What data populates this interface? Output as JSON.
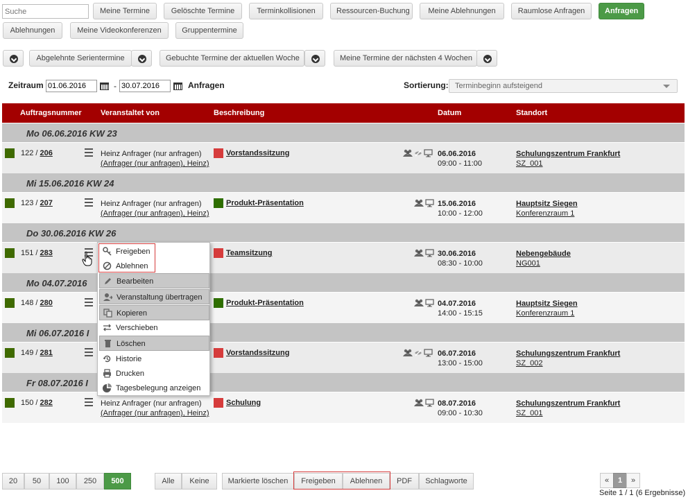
{
  "search": {
    "placeholder": "Suche"
  },
  "tabs": [
    "Meine Termine",
    "Gelöschte Termine",
    "Terminkollisionen",
    "Ressourcen-Buchung",
    "Meine Ablehnungen",
    "Raumlose Anfragen",
    "Anfragen",
    "Ablehnungen",
    "Meine Videokonferenzen",
    "Gruppentermine"
  ],
  "active_tab": "Anfragen",
  "quick_filters": [
    "Abgelehnte Serientermine",
    "Gebuchte Termine der aktuellen Woche",
    "Meine Termine der nächsten 4 Wochen"
  ],
  "filter": {
    "range_label": "Zeitraum",
    "date_from": "01.06.2016",
    "separator": "-",
    "date_to": "30.07.2016",
    "submit": "Anfragen",
    "sort_label": "Sortierung:",
    "sort_value": "Terminbeginn aufsteigend"
  },
  "columns": [
    "Auftragsnummer",
    "Veranstaltet von",
    "Beschreibung",
    "Datum",
    "Standort"
  ],
  "groups": [
    {
      "label": "Mo 06.06.2016 KW 23"
    },
    {
      "label": "Mi 15.06.2016 KW 24"
    },
    {
      "label": "Do 30.06.2016 KW 26"
    },
    {
      "label": "Mo 04.07.2016"
    },
    {
      "label": "Mi 06.07.2016 I"
    },
    {
      "label": "Fr 08.07.2016 I"
    }
  ],
  "rows": [
    {
      "num": "122 / ",
      "link": "206",
      "org1": "Heinz Anfrager (nur anfragen)",
      "org2": "(Anfrager (nur anfragen), Heinz)",
      "desc": "Vorstandssitzung",
      "desc_color": "#d63c3c",
      "date": "06.06.2016",
      "time": "09:00 - 11:00",
      "loc": "Schulungszentrum Frankfurt",
      "room": "SZ_001",
      "icons": [
        "group-icon",
        "eye-slash-icon",
        "monitor-icon"
      ]
    },
    {
      "num": "123 / ",
      "link": "207",
      "org1": "Heinz Anfrager (nur anfragen)",
      "org2": "(Anfrager (nur anfragen), Heinz)",
      "desc": "Produkt-Präsentation",
      "desc_color": "#2e6e00",
      "date": "15.06.2016",
      "time": "10:00 - 12:00",
      "loc": "Hauptsitz Siegen",
      "room": "Konferenzraum 1",
      "icons": [
        "group-icon",
        "monitor-icon"
      ]
    },
    {
      "num": "151 / ",
      "link": "283",
      "org1": "",
      "org2": "",
      "desc": "Teamsitzung",
      "desc_color": "#d63c3c",
      "date": "30.06.2016",
      "time": "08:30 - 10:00",
      "loc": "Nebengebäude",
      "room": "NG001",
      "icons": [
        "group-icon",
        "monitor-icon"
      ]
    },
    {
      "num": "148 / ",
      "link": "280",
      "org1": "",
      "org2": "",
      "desc": "Produkt-Präsentation",
      "desc_color": "#2e6e00",
      "date": "04.07.2016",
      "time": "14:00 - 15:15",
      "loc": "Hauptsitz Siegen",
      "room": "Konferenzraum 1",
      "icons": [
        "group-icon",
        "monitor-icon"
      ]
    },
    {
      "num": "149 / ",
      "link": "281",
      "org1": "",
      "org2": "",
      "desc": "Vorstandssitzung",
      "desc_color": "#d63c3c",
      "date": "06.07.2016",
      "time": "13:00 - 15:00",
      "loc": "Schulungszentrum Frankfurt",
      "room": "SZ_002",
      "icons": [
        "group-icon",
        "eye-slash-icon",
        "monitor-icon"
      ]
    },
    {
      "num": "150 / ",
      "link": "282",
      "org1": "Heinz Anfrager (nur anfragen)",
      "org2": "(Anfrager (nur anfragen), Heinz)",
      "desc": "Schulung",
      "desc_color": "#d63c3c",
      "date": "08.07.2016",
      "time": "09:00 - 10:30",
      "loc": "Schulungszentrum Frankfurt",
      "room": "SZ_001",
      "icons": [
        "group-icon",
        "monitor-icon"
      ]
    }
  ],
  "context_menu": [
    {
      "label": "Freigeben",
      "icon": "approve-icon"
    },
    {
      "label": "Ablehnen",
      "icon": "block-icon"
    },
    {
      "label": "Bearbeiten",
      "icon": "pencil-icon"
    },
    {
      "label": "Veranstaltung übertragen",
      "icon": "user-transfer-icon"
    },
    {
      "label": "Kopieren",
      "icon": "copy-icon"
    },
    {
      "label": "Verschieben",
      "icon": "arrows-icon"
    },
    {
      "label": "Löschen",
      "icon": "trash-icon"
    },
    {
      "label": "Historie",
      "icon": "history-icon"
    },
    {
      "label": "Drucken",
      "icon": "print-icon"
    },
    {
      "label": "Tagesbelegung anzeigen",
      "icon": "pie-chart-icon"
    }
  ],
  "footer": {
    "page_sizes": [
      "20",
      "50",
      "100",
      "250",
      "500"
    ],
    "active_page_size": "500",
    "select_all": "Alle",
    "select_none": "Keine",
    "delete_marked": "Markierte löschen",
    "approve": "Freigeben",
    "reject": "Ablehnen",
    "pdf": "PDF",
    "tags": "Schlagworte",
    "prev": "«",
    "page": "1",
    "next": "»",
    "summary": "Seite 1 / 1 (6 Ergebnisse)"
  }
}
